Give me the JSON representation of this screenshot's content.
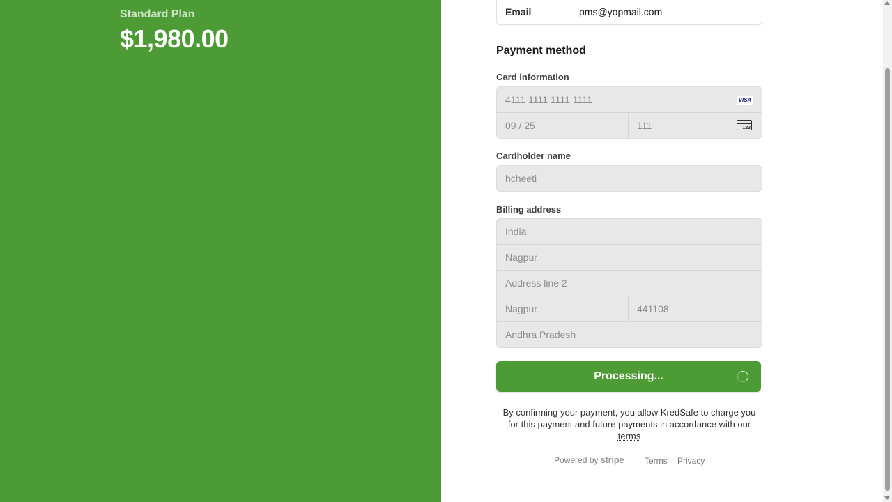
{
  "summary": {
    "plan_name": "Standard Plan",
    "price": "$1,980.00"
  },
  "email": {
    "label": "Email",
    "value": "pms@yopmail.com"
  },
  "payment": {
    "section_title": "Payment method",
    "card_label": "Card information",
    "card_number": "4111 1111 1111 1111",
    "card_brand": "VISA",
    "expiry": "09 / 25",
    "cvc": "111",
    "cvc_icon_text": "123",
    "cardholder_label": "Cardholder name",
    "cardholder_name": "hcheeti"
  },
  "billing": {
    "label": "Billing address",
    "country": "India",
    "line1": "Nagpur",
    "line2_placeholder": "Address line 2",
    "city": "Nagpur",
    "postal": "441108",
    "state": "Andhra Pradesh"
  },
  "submit": {
    "label": "Processing..."
  },
  "consent": {
    "text": "By confirming your payment, you allow KredSafe to charge you for this payment and future payments in accordance with our ",
    "link": "terms"
  },
  "footer": {
    "powered_by": "Powered by",
    "stripe": "stripe",
    "terms": "Terms",
    "privacy": "Privacy"
  },
  "colors": {
    "brand_green": "#4c9b34",
    "field_bg": "#e8e8e8"
  },
  "icons": {
    "card_brand": "visa-icon",
    "cvc": "cvc-card-icon",
    "loading": "spinner-icon"
  }
}
